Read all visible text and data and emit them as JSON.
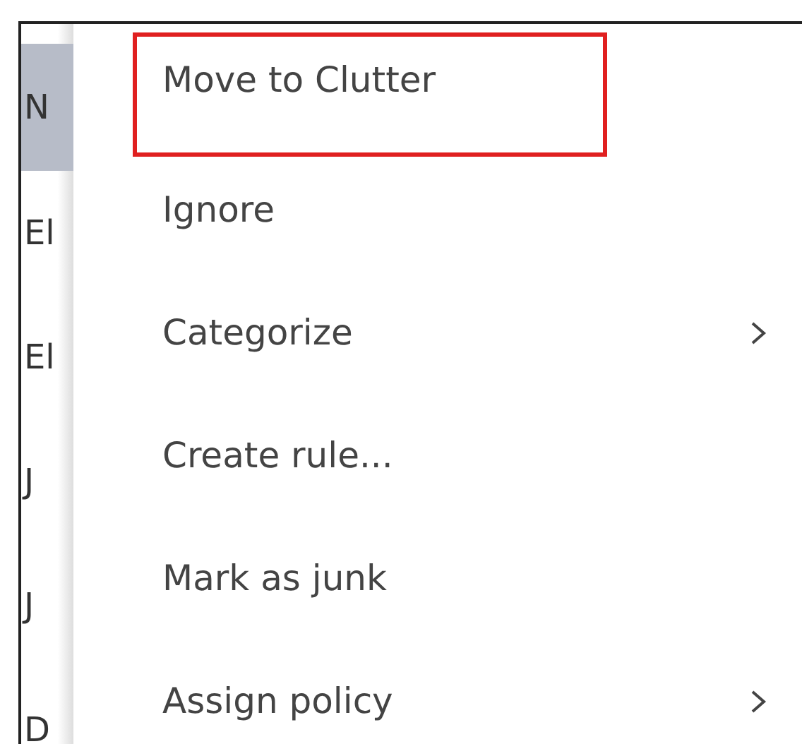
{
  "message_list": [
    {
      "sender": "N",
      "selected": true
    },
    {
      "sender": "El",
      "selected": false
    },
    {
      "sender": "El",
      "selected": false
    },
    {
      "sender": "J",
      "selected": false
    },
    {
      "sender": "J",
      "selected": false
    },
    {
      "sender": "D",
      "selected": false
    }
  ],
  "context_menu": [
    {
      "label": "Move to Clutter",
      "highlighted": true,
      "submenu": false
    },
    {
      "label": "Ignore",
      "highlighted": false,
      "submenu": false
    },
    {
      "label": "Categorize",
      "highlighted": false,
      "submenu": true
    },
    {
      "label": "Create rule...",
      "highlighted": false,
      "submenu": false
    },
    {
      "label": "Mark as junk",
      "highlighted": false,
      "submenu": false
    },
    {
      "label": "Assign policy",
      "highlighted": false,
      "submenu": true
    }
  ]
}
